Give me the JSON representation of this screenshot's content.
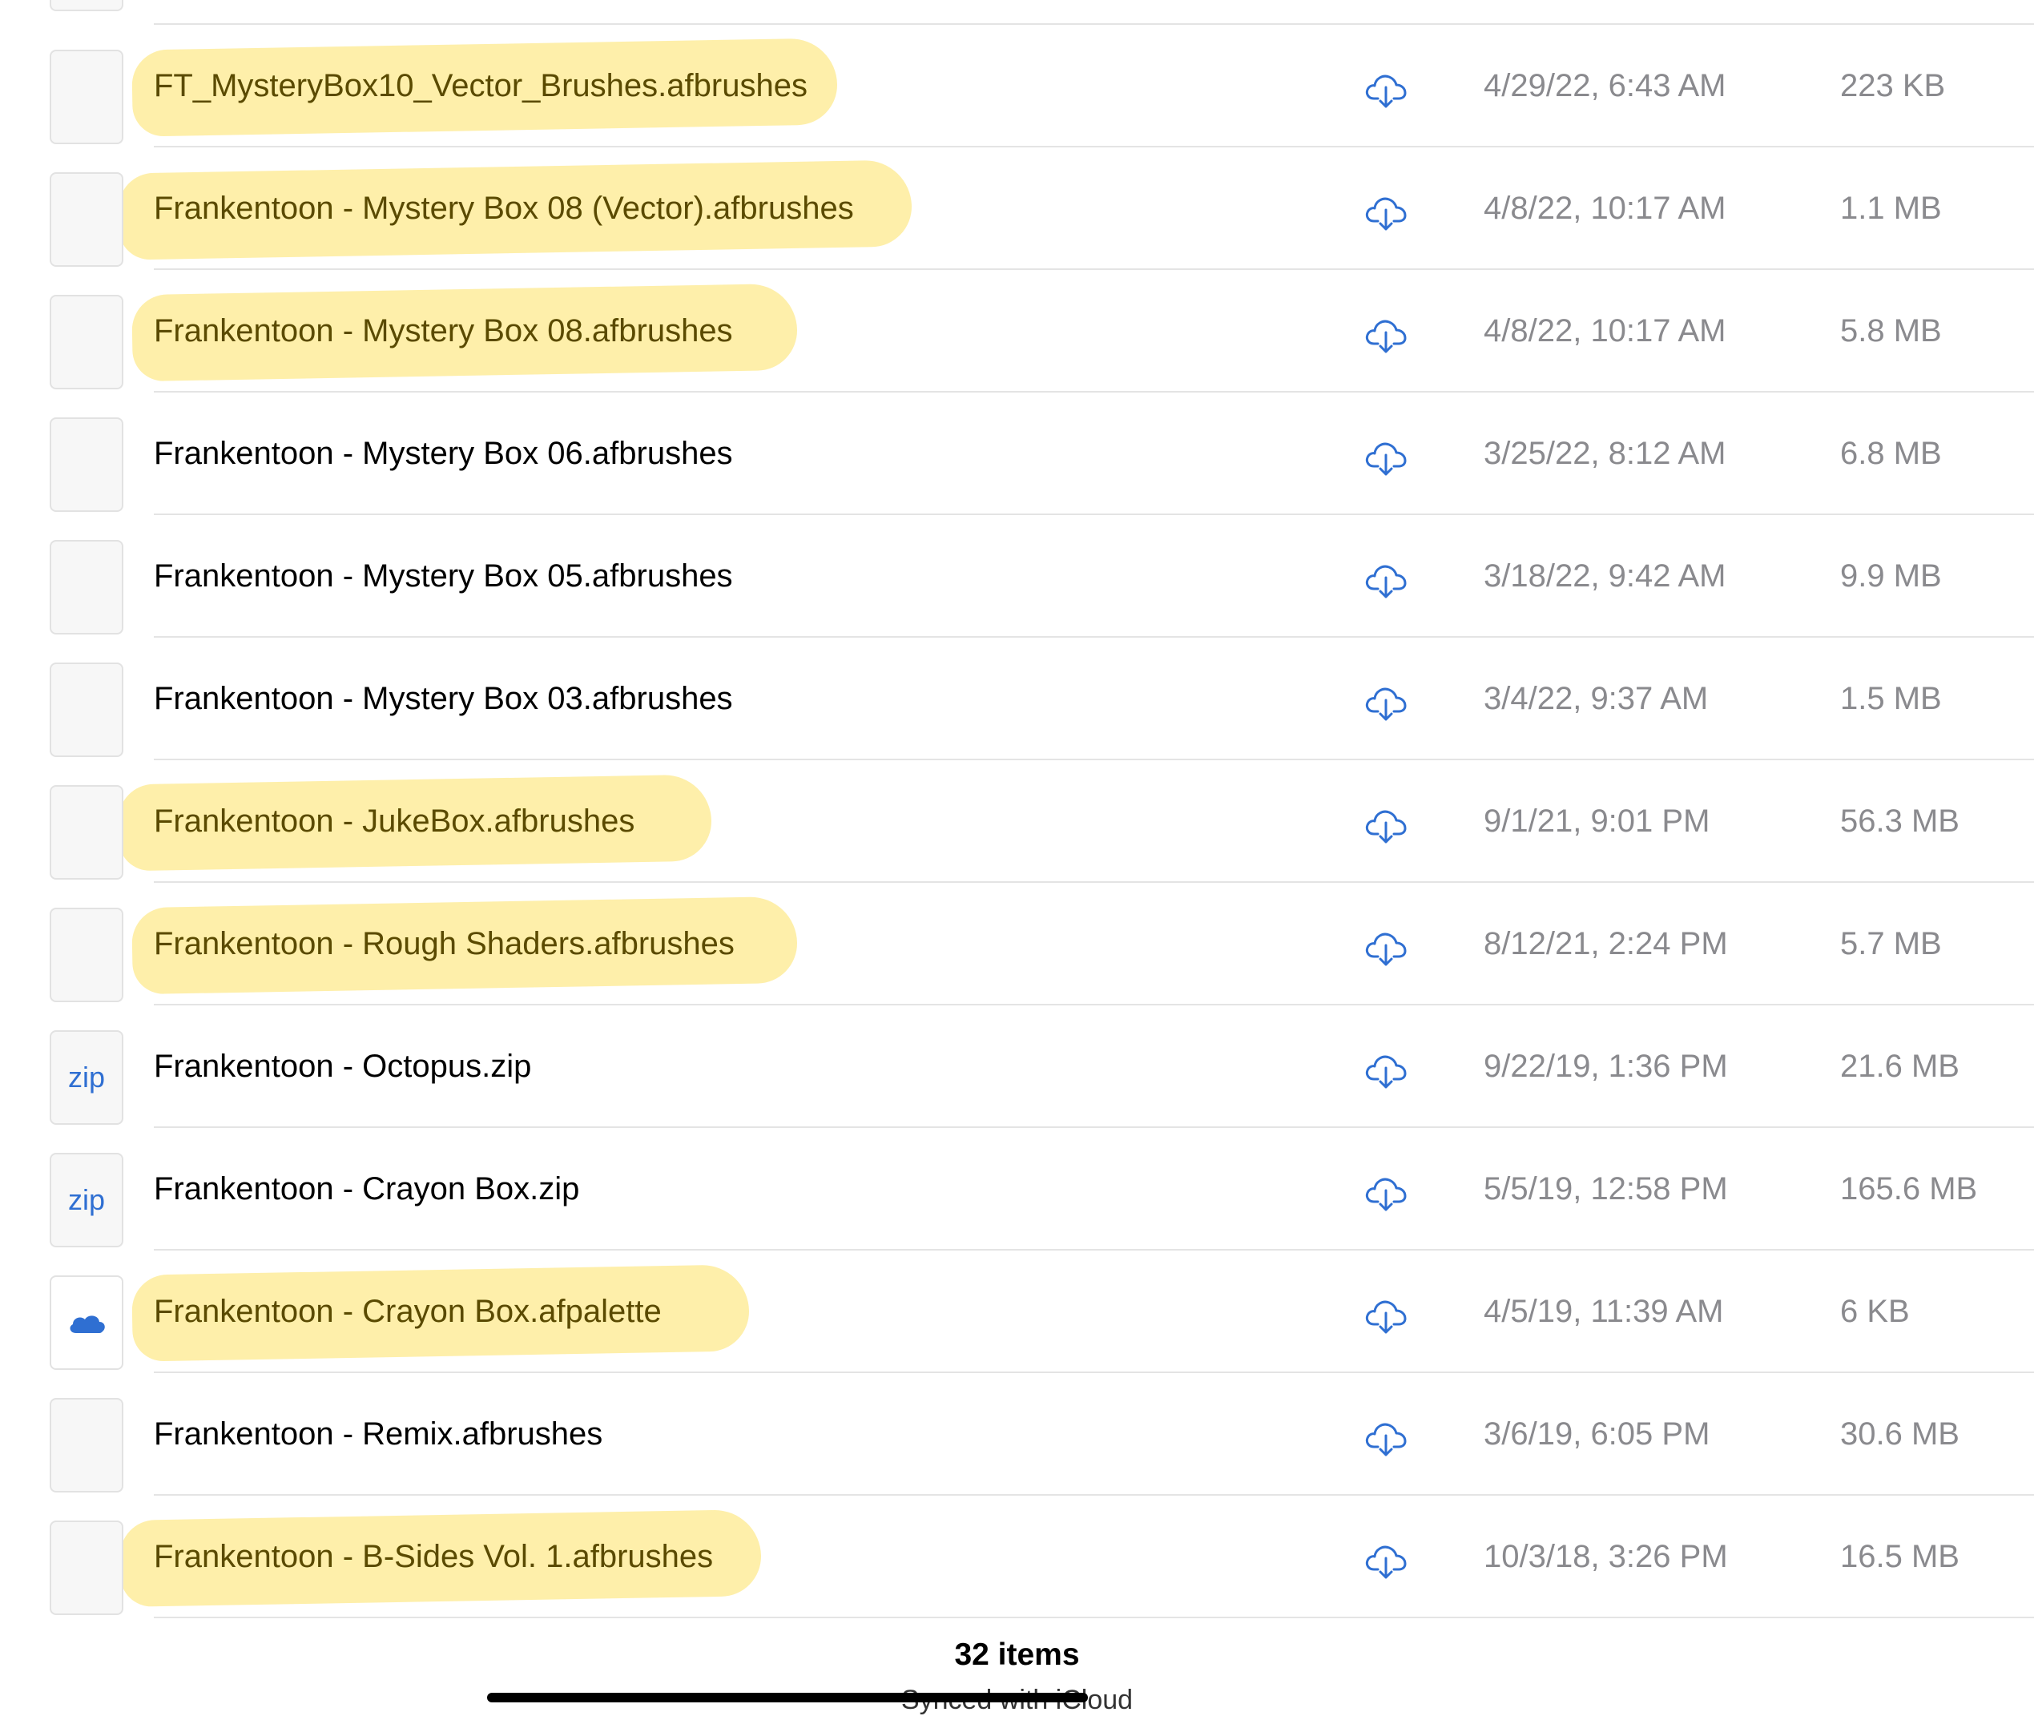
{
  "files": [
    {
      "name": "FT_MysteryBox10_Vector_Brushes.afbrushes",
      "date": "4/29/22, 6:43 AM",
      "size": "223 KB",
      "thumb": "blank",
      "highlighted": true,
      "action_icon": "cloud-download-icon"
    },
    {
      "name": "Frankentoon - Mystery Box 08 (Vector).afbrushes",
      "date": "4/8/22, 10:17 AM",
      "size": "1.1 MB",
      "thumb": "blank",
      "highlighted": true,
      "action_icon": "cloud-download-icon"
    },
    {
      "name": "Frankentoon - Mystery Box 08.afbrushes",
      "date": "4/8/22, 10:17 AM",
      "size": "5.8 MB",
      "thumb": "blank",
      "highlighted": true,
      "action_icon": "cloud-download-icon"
    },
    {
      "name": "Frankentoon - Mystery Box 06.afbrushes",
      "date": "3/25/22, 8:12 AM",
      "size": "6.8 MB",
      "thumb": "blank",
      "highlighted": false,
      "action_icon": "cloud-download-icon"
    },
    {
      "name": "Frankentoon - Mystery Box 05.afbrushes",
      "date": "3/18/22, 9:42 AM",
      "size": "9.9 MB",
      "thumb": "blank",
      "highlighted": false,
      "action_icon": "cloud-download-icon"
    },
    {
      "name": "Frankentoon - Mystery Box 03.afbrushes",
      "date": "3/4/22, 9:37 AM",
      "size": "1.5 MB",
      "thumb": "blank",
      "highlighted": false,
      "action_icon": "cloud-download-icon"
    },
    {
      "name": "Frankentoon - JukeBox.afbrushes",
      "date": "9/1/21, 9:01 PM",
      "size": "56.3 MB",
      "thumb": "blank",
      "highlighted": true,
      "action_icon": "cloud-download-icon"
    },
    {
      "name": "Frankentoon - Rough Shaders.afbrushes",
      "date": "8/12/21, 2:24 PM",
      "size": "5.7 MB",
      "thumb": "blank",
      "highlighted": true,
      "action_icon": "cloud-download-icon"
    },
    {
      "name": "Frankentoon - Octopus.zip",
      "date": "9/22/19, 1:36 PM",
      "size": "21.6 MB",
      "thumb": "zip",
      "thumb_label": "zip",
      "highlighted": false,
      "action_icon": "cloud-download-icon"
    },
    {
      "name": "Frankentoon - Crayon Box.zip",
      "date": "5/5/19, 12:58 PM",
      "size": "165.6 MB",
      "thumb": "zip",
      "thumb_label": "zip",
      "highlighted": false,
      "action_icon": "cloud-download-icon"
    },
    {
      "name": "Frankentoon - Crayon Box.afpalette",
      "date": "4/5/19, 11:39 AM",
      "size": "6 KB",
      "thumb": "palette",
      "highlighted": true,
      "action_icon": "cloud-download-icon"
    },
    {
      "name": "Frankentoon - Remix.afbrushes",
      "date": "3/6/19, 6:05 PM",
      "size": "30.6 MB",
      "thumb": "blank",
      "highlighted": false,
      "action_icon": "cloud-download-icon"
    },
    {
      "name": "Frankentoon - B-Sides Vol. 1.afbrushes",
      "date": "10/3/18, 3:26 PM",
      "size": "16.5 MB",
      "thumb": "blank",
      "highlighted": true,
      "action_icon": "cloud-download-icon"
    }
  ],
  "footer": {
    "item_count": "32 items",
    "sync_status": "Synced with iCloud"
  },
  "colors": {
    "accent": "#2f6fd2",
    "highlight": "#fde264",
    "secondary_text": "#8a8a8e",
    "separator": "#e4e4e4"
  }
}
